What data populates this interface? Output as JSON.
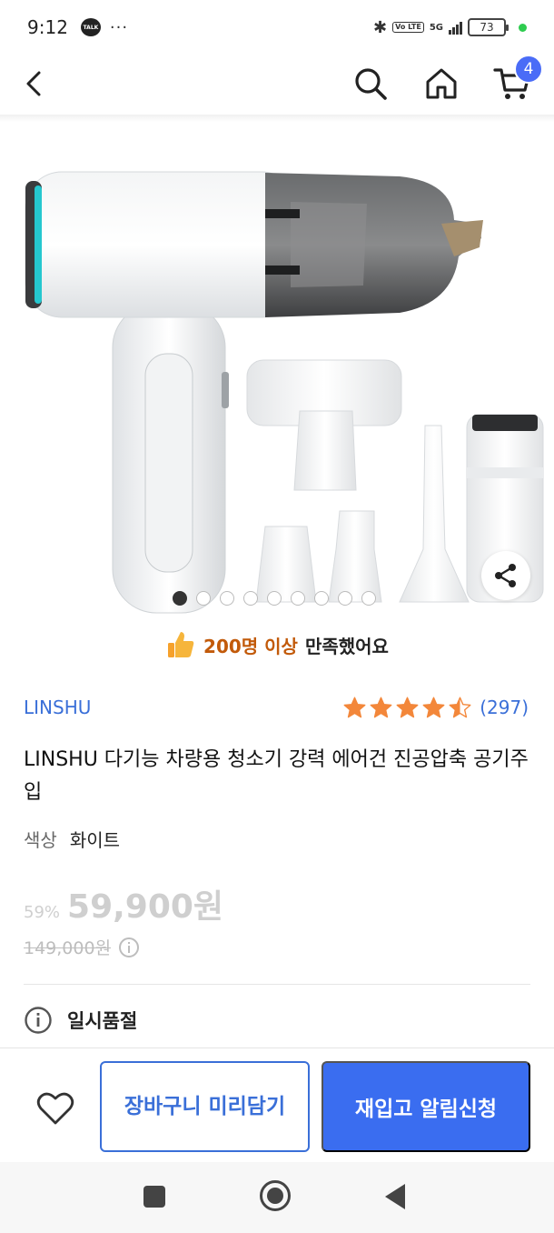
{
  "status_bar": {
    "time": "9:12",
    "talk_icon_text": "TALK",
    "more": "···",
    "network": "5G",
    "volte": "Vo LTE",
    "battery": "73"
  },
  "header": {
    "back_icon": "chevron-left-icon",
    "search_icon": "search-icon",
    "home_icon": "home-icon",
    "cart_icon": "cart-icon",
    "cart_badge": "4"
  },
  "product_image": {
    "slide_count": 9,
    "active_index": 0,
    "share_icon": "share-icon"
  },
  "satisfaction": {
    "highlight": "200명 이상",
    "rest": "만족했어요",
    "icon": "thumbs-up-icon"
  },
  "product": {
    "brand": "LINSHU",
    "rating": 4.5,
    "review_count": "(297)",
    "title": "LINSHU 다기능 차량용 청소기 강력 에어건 진공압축 공기주입",
    "option_label": "색상",
    "option_value": "화이트",
    "discount": "59%",
    "price": "59,900원",
    "original_price": "149,000원",
    "soldout": "일시품절"
  },
  "actions": {
    "wish_icon": "heart-icon",
    "cart_later": "장바구니 미리담기",
    "restock": "재입고 알림신청"
  },
  "colors": {
    "accent": "#3a6df0",
    "brand_link": "#3a6fd8",
    "badge": "#4a6cf7",
    "highlight": "#c25a0a",
    "star": "#f3873a"
  }
}
